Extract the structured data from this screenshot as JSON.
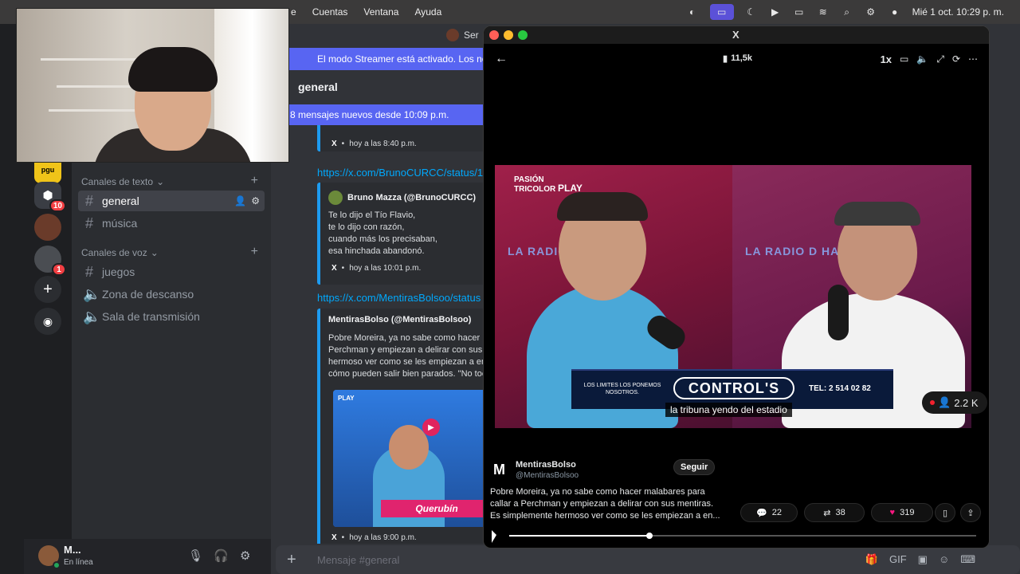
{
  "menubar": {
    "menu_items": [
      "e",
      "Cuentas",
      "Ventana",
      "Ayuda"
    ],
    "datetime": "Mié 1 oct. 10:29 p. m."
  },
  "servers": {
    "badges": [
      "10",
      "1"
    ]
  },
  "channels": {
    "text_category": "Canales de texto",
    "voice_category": "Canales de voz",
    "text": [
      {
        "name": "general",
        "active": true
      },
      {
        "name": "música",
        "active": false
      }
    ],
    "voice": [
      {
        "name": "juegos",
        "type": "text"
      },
      {
        "name": "Zona de descanso",
        "type": "voice"
      },
      {
        "name": "Sala de transmisión",
        "type": "voice"
      }
    ]
  },
  "user": {
    "name": "M...",
    "status": "En línea"
  },
  "chat": {
    "header_server": "Ser",
    "streamer_notice": "El modo Streamer está activado. Los nom",
    "channel": "general",
    "new_messages": "8 mensajes nuevos desde 10:09 p.m.",
    "input_placeholder": "Mensaje #general",
    "messages": [
      {
        "footer": "X",
        "time": "hoy a las 8:40 p.m."
      },
      {
        "link": "https://x.com/BrunoCURCC/status/1",
        "author": "Bruno Mazza (@BrunoCURCC)",
        "text": "Te lo dijo el Tío Flavio,\nte lo dijo con razón,\ncuando más los precisaban,\nesa hinchada abandonó.",
        "footer": "X",
        "time": "hoy a las 10:01 p.m."
      },
      {
        "link": "https://x.com/MentirasBolsoo/status",
        "author": "MentirasBolso (@MentirasBolsoo)",
        "text": "Pobre Moreira, ya no sabe como hacer m\nPerchman y empiezan a delirar con sus m\nhermoso ver como se les empiezan a ent\ncómo pueden salir bien parados. \"No toc",
        "footer": "X",
        "time": "hoy a las 9:00 p.m.",
        "thumb_brand": "PLAY",
        "thumb_label": "Querubín"
      }
    ]
  },
  "xwindow": {
    "logo": "X",
    "views": "11,5k",
    "speed": "1x",
    "video": {
      "brand_top": "PASIÓN\nTRICOLOR",
      "brand_play": "PLAY",
      "radio_text_left": "LA RADIO   HINCHA",
      "radio_text_right": "LA RADIO D    HA",
      "banner_small": "LOS LIMITES LOS PONEMOS NOSOTROS.",
      "banner_main": "CONTROL'S",
      "banner_tel": "TEL: 2 514 02 82",
      "subtitle": "la tribuna yendo del estadio",
      "listeners": "2.2 K"
    },
    "tweet": {
      "avatar_letter": "M",
      "name": "MentirasBolso",
      "handle": "@MentirasBolsoo",
      "follow": "Seguir",
      "text": "Pobre Moreira, ya no sabe como hacer malabares para\ncallar a Perchman y empiezan a delirar con sus mentiras.\nEs simplemente hermoso ver como se les empiezan a en...",
      "replies": "22",
      "reposts": "38",
      "likes": "319"
    },
    "progress": 0.3
  },
  "colors": {
    "discord_blurple": "#5865f2",
    "link": "#00a8fc",
    "like": "#f91880",
    "online": "#23a55a"
  }
}
